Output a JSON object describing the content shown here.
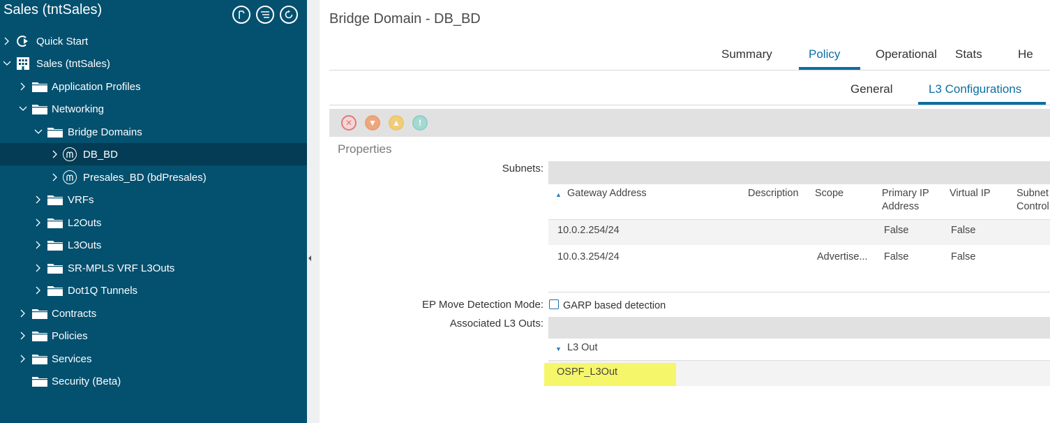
{
  "sidebar": {
    "title": "Sales (tntSales)",
    "header_icons": [
      "quick-links-icon",
      "list-filter-icon",
      "refresh-icon"
    ],
    "tree": [
      {
        "label": "Quick Start",
        "icon": "quick-start-icon",
        "expanded": false
      },
      {
        "label": "Sales (tntSales)",
        "icon": "building-icon",
        "expanded": true
      },
      {
        "label": "Application Profiles",
        "icon": "folder-icon",
        "expanded": false
      },
      {
        "label": "Networking",
        "icon": "folder-icon",
        "expanded": true
      },
      {
        "label": "Bridge Domains",
        "icon": "folder-icon",
        "expanded": true
      },
      {
        "label": "DB_BD",
        "icon": "bridge-domain-icon",
        "selected": true
      },
      {
        "label": "Presales_BD (bdPresales)",
        "icon": "bridge-domain-icon"
      },
      {
        "label": "VRFs",
        "icon": "folder-icon"
      },
      {
        "label": "L2Outs",
        "icon": "folder-icon"
      },
      {
        "label": "L3Outs",
        "icon": "folder-icon"
      },
      {
        "label": "SR-MPLS VRF L3Outs",
        "icon": "folder-icon"
      },
      {
        "label": "Dot1Q Tunnels",
        "icon": "folder-icon"
      },
      {
        "label": "Contracts",
        "icon": "folder-icon"
      },
      {
        "label": "Policies",
        "icon": "folder-icon"
      },
      {
        "label": "Services",
        "icon": "folder-icon"
      },
      {
        "label": "Security (Beta)",
        "icon": "folder-icon"
      }
    ]
  },
  "main": {
    "title": "Bridge Domain - DB_BD",
    "tabs": [
      "Summary",
      "Policy",
      "Operational",
      "Stats",
      "He"
    ],
    "active_tab": "Policy",
    "subtabs": [
      "General",
      "L3 Configurations"
    ],
    "active_subtab": "L3 Configurations",
    "fault_icons": [
      "critical-fault-icon",
      "major-fault-icon",
      "minor-fault-icon",
      "warning-fault-icon"
    ],
    "properties_label": "Properties",
    "subnets": {
      "label": "Subnets:",
      "columns": [
        "Gateway Address",
        "Description",
        "Scope",
        "Primary IP Address",
        "Virtual IP",
        "Subnet Control"
      ],
      "rows": [
        {
          "gateway": "10.0.2.254/24",
          "description": "",
          "scope": "",
          "primary_ip": "False",
          "virtual_ip": "False",
          "subnet_control": ""
        },
        {
          "gateway": "10.0.3.254/24",
          "description": "",
          "scope": "Advertise...",
          "primary_ip": "False",
          "virtual_ip": "False",
          "subnet_control": ""
        }
      ]
    },
    "ep_move": {
      "label": "EP Move Detection Mode:",
      "option": "GARP based detection",
      "checked": false
    },
    "l3outs": {
      "label": "Associated L3 Outs:",
      "column": "L3 Out",
      "rows": [
        "OSPF_L3Out"
      ]
    }
  },
  "colors": {
    "sidebar_bg": "#04506f",
    "accent": "#0b6ea1",
    "highlight": "#f6f66a"
  }
}
